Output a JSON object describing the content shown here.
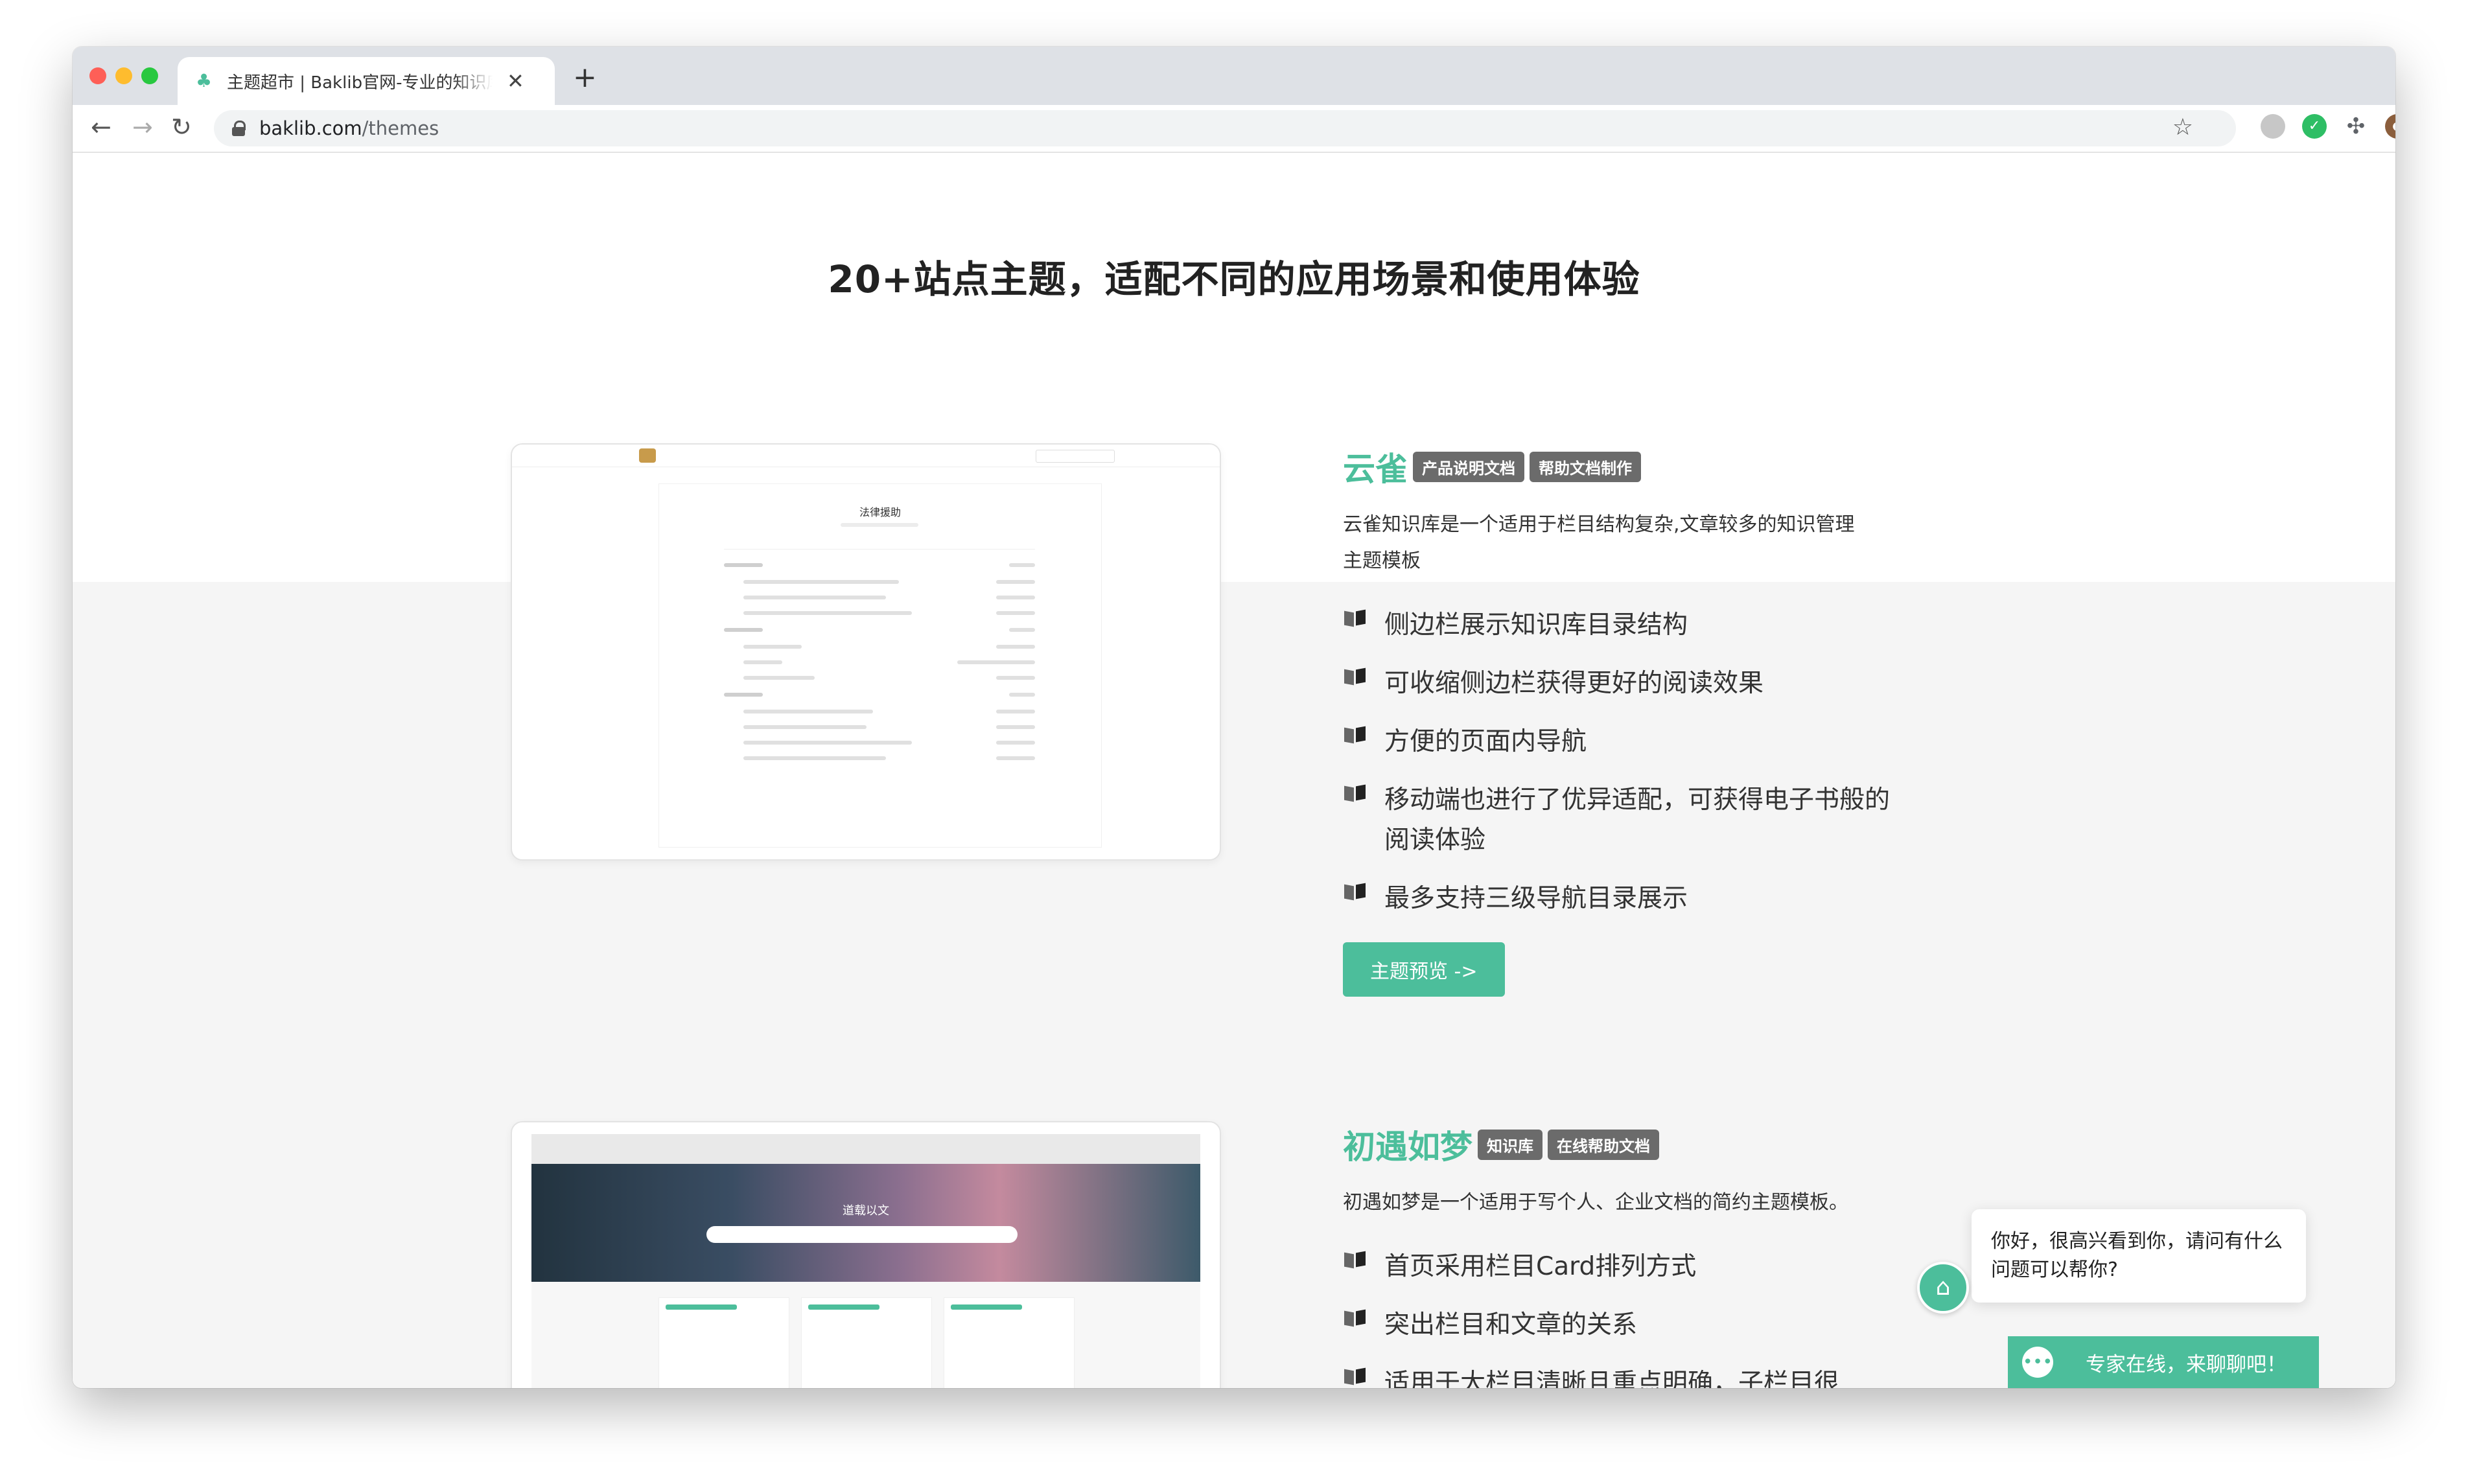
{
  "browser": {
    "tab_title": "主题超市 | Baklib官网-专业的知识库",
    "url_domain": "baklib.com",
    "url_path": "/themes",
    "new_tab": "+",
    "close": "✕"
  },
  "page": {
    "title": "20+站点主题，适配不同的应用场景和使用体验"
  },
  "themes": [
    {
      "name": "云雀",
      "tags": [
        "产品说明文档",
        "帮助文档制作"
      ],
      "description": "云雀知识库是一个适用于栏目结构复杂,文章较多的知识管理主题模板",
      "features": [
        "侧边栏展示知识库目录结构",
        "可收缩侧边栏获得更好的阅读效果",
        "方便的页面内导航",
        "移动端也进行了优异适配，可获得电子书般的阅读体验",
        "最多支持三级导航目录展示"
      ],
      "button": "主题预览  ->",
      "preview_title": "法律援助"
    },
    {
      "name": "初遇如梦",
      "tags": [
        "知识库",
        "在线帮助文档"
      ],
      "description": "初遇如梦是一个适用于写个人、企业文档的简约主题模板。",
      "features": [
        "首页采用栏目Card排列方式",
        "突出栏目和文章的关系",
        "适用于大栏目清晰且重点明确，子栏目很"
      ],
      "preview_title": "道载以文"
    }
  ],
  "chat": {
    "greeting": "你好，很高兴看到你，请问有什么问题可以帮你?",
    "bar_label": "专家在线，来聊聊吧！"
  },
  "colors": {
    "accent": "#4cbe9b",
    "tag_bg": "#6b6b6b"
  }
}
